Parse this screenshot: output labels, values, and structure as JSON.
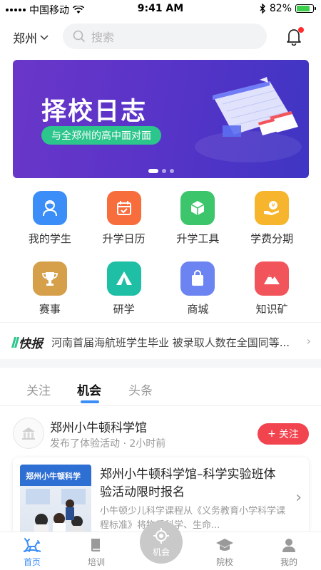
{
  "status_bar": {
    "carrier": "中国移动",
    "time": "9:41 AM",
    "battery": "82%",
    "battery_level": 0.82
  },
  "header": {
    "city": "郑州",
    "search_placeholder": "搜索"
  },
  "banner": {
    "title": "择校日志",
    "subtitle": "与全郑州的高中面对面",
    "page_count": 3,
    "active_page": 1
  },
  "grid": {
    "items": [
      {
        "label": "我的学生",
        "icon": "student-icon",
        "color": "#3b8ef7"
      },
      {
        "label": "升学日历",
        "icon": "calendar-icon",
        "color": "#f76d3b"
      },
      {
        "label": "升学工具",
        "icon": "cube-icon",
        "color": "#3cc56a"
      },
      {
        "label": "学费分期",
        "icon": "coin-hand-icon",
        "color": "#f6b52d"
      },
      {
        "label": "赛事",
        "icon": "trophy-icon",
        "color": "#d6a04b"
      },
      {
        "label": "研学",
        "icon": "tent-icon",
        "color": "#1fbfa6"
      },
      {
        "label": "商城",
        "icon": "shopping-bag-icon",
        "color": "#6c83f2"
      },
      {
        "label": "知识矿",
        "icon": "mountain-icon",
        "color": "#f2545b"
      }
    ]
  },
  "news": {
    "tag": "快报",
    "text": "河南首届海航班学生毕业 被录取人数在全国同等..."
  },
  "tabs": {
    "items": [
      "关注",
      "机会",
      "头条"
    ],
    "active": 1
  },
  "feed": {
    "org_name": "郑州小牛顿科学馆",
    "meta": "发布了体验活动 · 2小时前",
    "follow_label": "关注",
    "card": {
      "title": "郑州小牛顿科学馆–科学实验班体验活动限时报名",
      "desc": "小牛顿少儿科学课程从《义务教育小学科学课程标准》将物质科学、生命...",
      "thumb_text": "郑州小牛顿科学"
    }
  },
  "bottom_nav": {
    "items": [
      {
        "label": "首页",
        "icon": "deer-icon"
      },
      {
        "label": "培训",
        "icon": "book-icon"
      },
      {
        "label": "机会",
        "icon": "target-icon"
      },
      {
        "label": "院校",
        "icon": "graduation-cap-icon"
      },
      {
        "label": "我的",
        "icon": "person-icon"
      }
    ],
    "active": 0
  }
}
